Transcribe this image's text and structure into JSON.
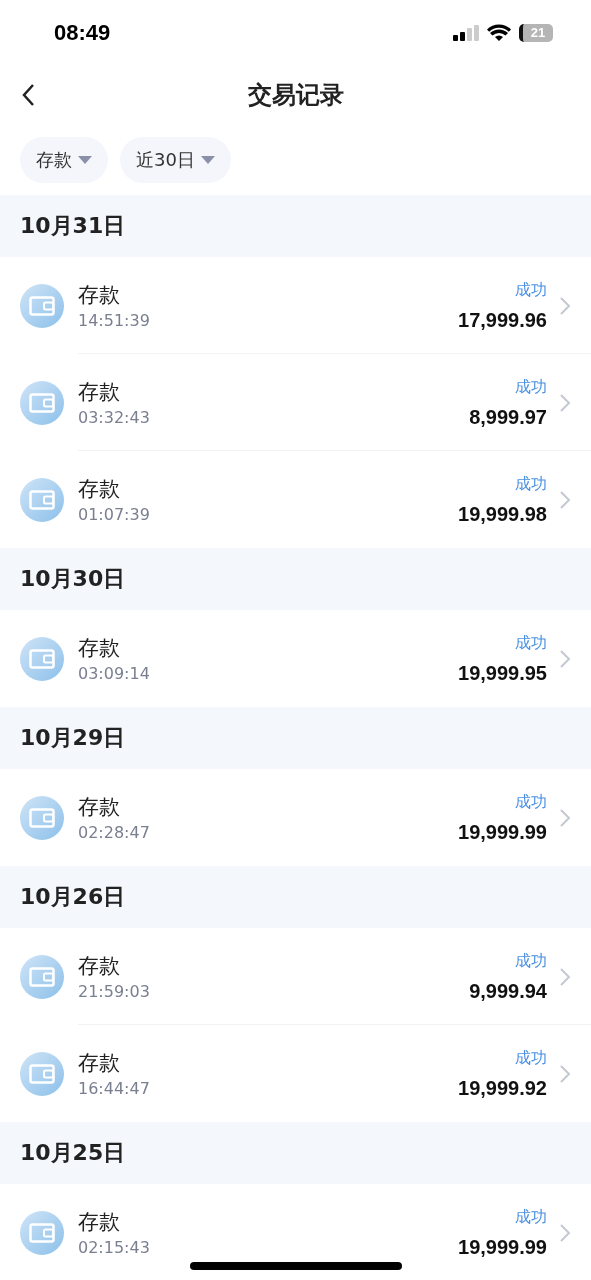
{
  "status_bar": {
    "time": "08:49",
    "battery": "21"
  },
  "header": {
    "title": "交易记录"
  },
  "filters": [
    {
      "label": "存款"
    },
    {
      "label": "近30日"
    }
  ],
  "groups": [
    {
      "date": "10月31日",
      "items": [
        {
          "name": "存款",
          "time": "14:51:39",
          "status": "成功",
          "amount": "17,999.96"
        },
        {
          "name": "存款",
          "time": "03:32:43",
          "status": "成功",
          "amount": "8,999.97"
        },
        {
          "name": "存款",
          "time": "01:07:39",
          "status": "成功",
          "amount": "19,999.98"
        }
      ]
    },
    {
      "date": "10月30日",
      "items": [
        {
          "name": "存款",
          "time": "03:09:14",
          "status": "成功",
          "amount": "19,999.95"
        }
      ]
    },
    {
      "date": "10月29日",
      "items": [
        {
          "name": "存款",
          "time": "02:28:47",
          "status": "成功",
          "amount": "19,999.99"
        }
      ]
    },
    {
      "date": "10月26日",
      "items": [
        {
          "name": "存款",
          "time": "21:59:03",
          "status": "成功",
          "amount": "9,999.94"
        },
        {
          "name": "存款",
          "time": "16:44:47",
          "status": "成功",
          "amount": "19,999.92"
        }
      ]
    },
    {
      "date": "10月25日",
      "items": [
        {
          "name": "存款",
          "time": "02:15:43",
          "status": "成功",
          "amount": "19,999.99"
        }
      ]
    }
  ]
}
